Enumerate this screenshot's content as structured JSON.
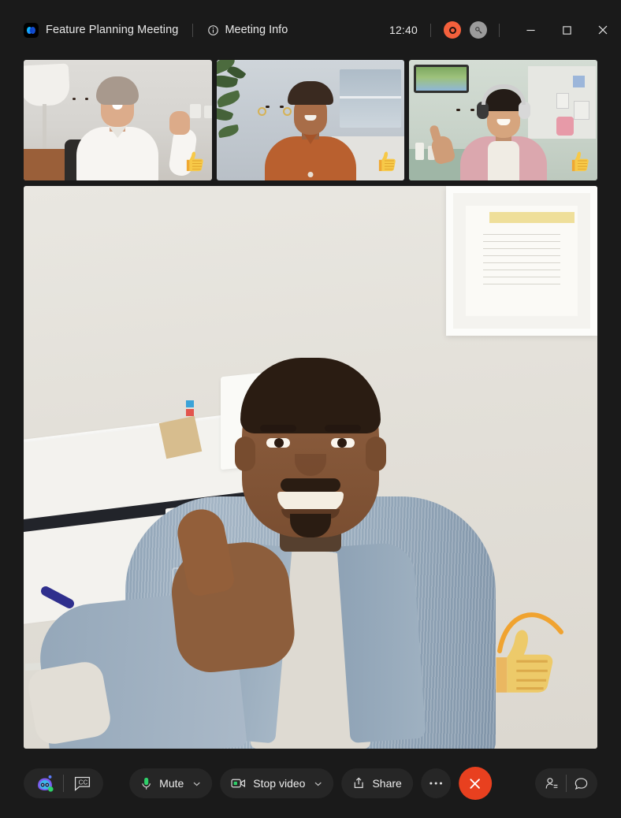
{
  "window": {
    "app": "Webex",
    "background_color": "#1a1a1a"
  },
  "title_bar": {
    "logo_icon": "webex-logo-icon",
    "meeting_title": "Feature Planning Meeting",
    "info_icon": "info-circle-icon",
    "meeting_info_label": "Meeting Info",
    "timer": "12:40",
    "recording_icon": "record-indicator-icon",
    "recording_color": "#f4603c",
    "lock_icon": "key-icon",
    "lock_color": "#9b9b9b",
    "minimize_label": "Minimize",
    "maximize_label": "Maximize",
    "close_label": "Close"
  },
  "stage": {
    "thumbnails": [
      {
        "id": "participant-1",
        "reaction": "thumbs-up",
        "description": "Woman waving in white shirt"
      },
      {
        "id": "participant-2",
        "reaction": "thumbs-up",
        "description": "Woman in orange top by window"
      },
      {
        "id": "participant-3",
        "reaction": "thumbs-up",
        "description": "Woman with headphones in pink cardigan"
      }
    ],
    "main_speaker": {
      "id": "active-speaker",
      "reaction": "thumbs-up",
      "reaction_arc_color": "#f0a330",
      "description": "Man in blue denim jacket giving a thumbs up"
    }
  },
  "controls": {
    "assistant_icon": "ai-assistant-icon",
    "captions_icon": "closed-captions-icon",
    "captions_label": "CC",
    "mute": {
      "icon": "microphone-icon",
      "label": "Mute",
      "state_color": "#2fd16a",
      "chevron": "chevron-down-icon"
    },
    "video": {
      "icon": "camera-icon",
      "label": "Stop video",
      "state_color": "#2fd16a",
      "chevron": "chevron-down-icon"
    },
    "share": {
      "icon": "share-upload-icon",
      "label": "Share"
    },
    "more": {
      "icon": "more-horizontal-icon",
      "label": "···"
    },
    "end_call": {
      "icon": "close-x-icon",
      "label": "End meeting",
      "color": "#e8401f"
    },
    "participants": {
      "icon": "participants-icon",
      "label": "Participants"
    },
    "chat": {
      "icon": "chat-bubble-icon",
      "label": "Chat"
    }
  }
}
